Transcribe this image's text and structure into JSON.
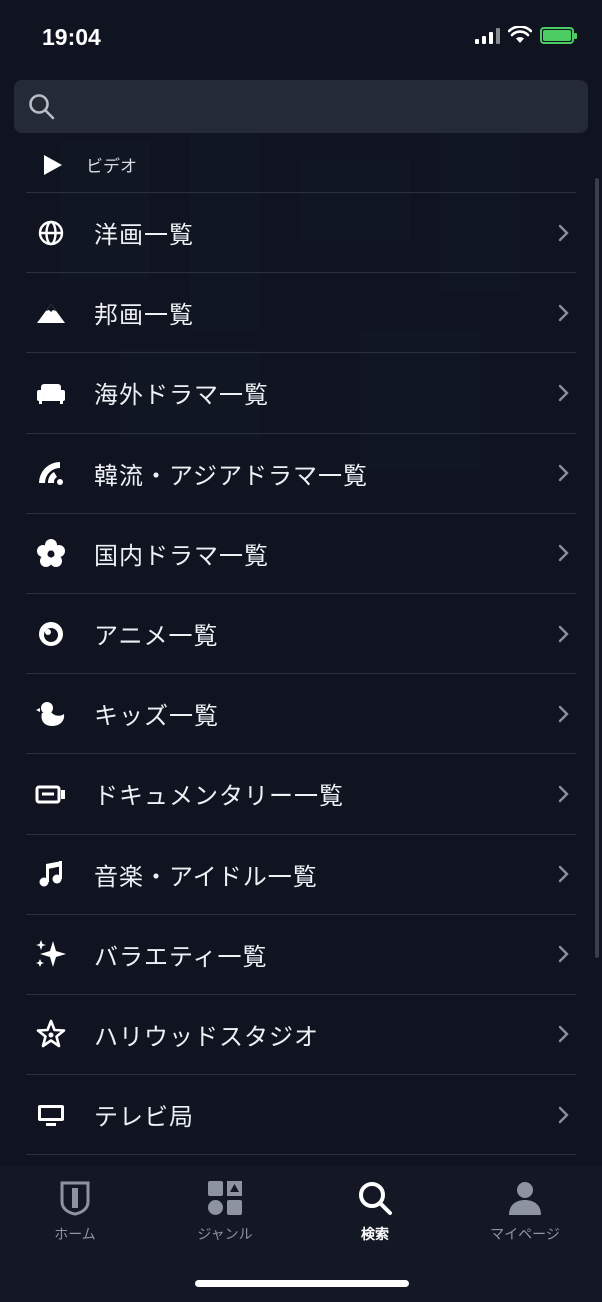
{
  "status": {
    "time": "19:04"
  },
  "search": {
    "placeholder": ""
  },
  "section": {
    "label": "ビデオ"
  },
  "items": [
    {
      "label": "洋画一覧",
      "icon": "globe-icon"
    },
    {
      "label": "邦画一覧",
      "icon": "mountain-icon"
    },
    {
      "label": "海外ドラマ一覧",
      "icon": "sofa-icon"
    },
    {
      "label": "韓流・アジアドラマ一覧",
      "icon": "fan-icon"
    },
    {
      "label": "国内ドラマ一覧",
      "icon": "sakura-icon"
    },
    {
      "label": "アニメ一覧",
      "icon": "anime-eye-icon"
    },
    {
      "label": "キッズ一覧",
      "icon": "duck-icon"
    },
    {
      "label": "ドキュメンタリー一覧",
      "icon": "camera-icon"
    },
    {
      "label": "音楽・アイドル一覧",
      "icon": "music-note-icon"
    },
    {
      "label": "バラエティ一覧",
      "icon": "sparkle-icon"
    },
    {
      "label": "ハリウッドスタジオ",
      "icon": "star-icon"
    },
    {
      "label": "テレビ局",
      "icon": "tv-icon"
    }
  ],
  "tabs": [
    {
      "label": "ホーム",
      "icon": "home-shield-icon"
    },
    {
      "label": "ジャンル",
      "icon": "genre-grid-icon"
    },
    {
      "label": "検索",
      "icon": "search-icon",
      "active": true
    },
    {
      "label": "マイページ",
      "icon": "person-icon"
    }
  ],
  "colors": {
    "background": "#0f1420",
    "search_bg": "#242a36",
    "battery": "#4ccd62"
  }
}
